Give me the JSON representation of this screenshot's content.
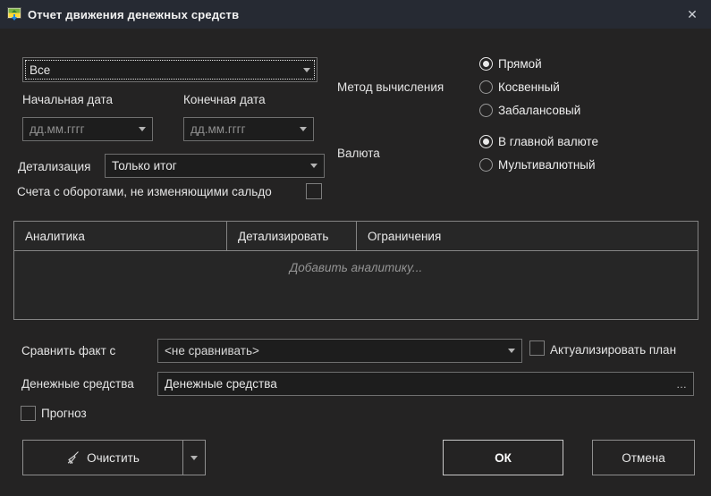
{
  "window": {
    "title": "Отчет движения денежных средств",
    "close_glyph": "✕"
  },
  "colors": {
    "titlebar_bg": "#262a33",
    "dialog_bg": "#242323",
    "field_bg": "#1d1d1d",
    "field_border": "#6f6f6f",
    "table_border": "#848484",
    "icon_green": "#7cb342",
    "icon_yellow": "#fdd835",
    "icon_blue": "#1e88e5"
  },
  "form": {
    "top_combo": {
      "value": "Все"
    },
    "start_date": {
      "label": "Начальная дата",
      "placeholder": "дд.мм.гггг"
    },
    "end_date": {
      "label": "Конечная дата",
      "placeholder": "дд.мм.гггг"
    },
    "method": {
      "label": "Метод вычисления",
      "options": [
        {
          "label": "Прямой",
          "selected": true
        },
        {
          "label": "Косвенный",
          "selected": false
        },
        {
          "label": "Забалансовый",
          "selected": false
        }
      ]
    },
    "currency": {
      "label": "Валюта",
      "options": [
        {
          "label": "В главной валюте",
          "selected": true
        },
        {
          "label": "Мультивалютный",
          "selected": false
        }
      ]
    },
    "detail": {
      "label": "Детализация",
      "value": "Только итог"
    },
    "saldo_checkbox": {
      "label": "Счета с оборотами, не изменяющими сальдо",
      "checked": false
    },
    "analytics_table": {
      "columns": [
        "Аналитика",
        "Детализировать",
        "Ограничения"
      ],
      "placeholder": "Добавить аналитику...",
      "rows": []
    },
    "compare": {
      "label": "Сравнить факт с",
      "value": "<не сравнивать>"
    },
    "actualize_plan": {
      "label": "Актуализировать план",
      "checked": false
    },
    "money": {
      "label": "Денежные средства",
      "value": "Денежные средства",
      "ellipsis": "…"
    },
    "forecast": {
      "label": "Прогноз",
      "checked": false
    }
  },
  "buttons": {
    "clear": "Очистить",
    "ok": "ОК",
    "cancel": "Отмена"
  }
}
